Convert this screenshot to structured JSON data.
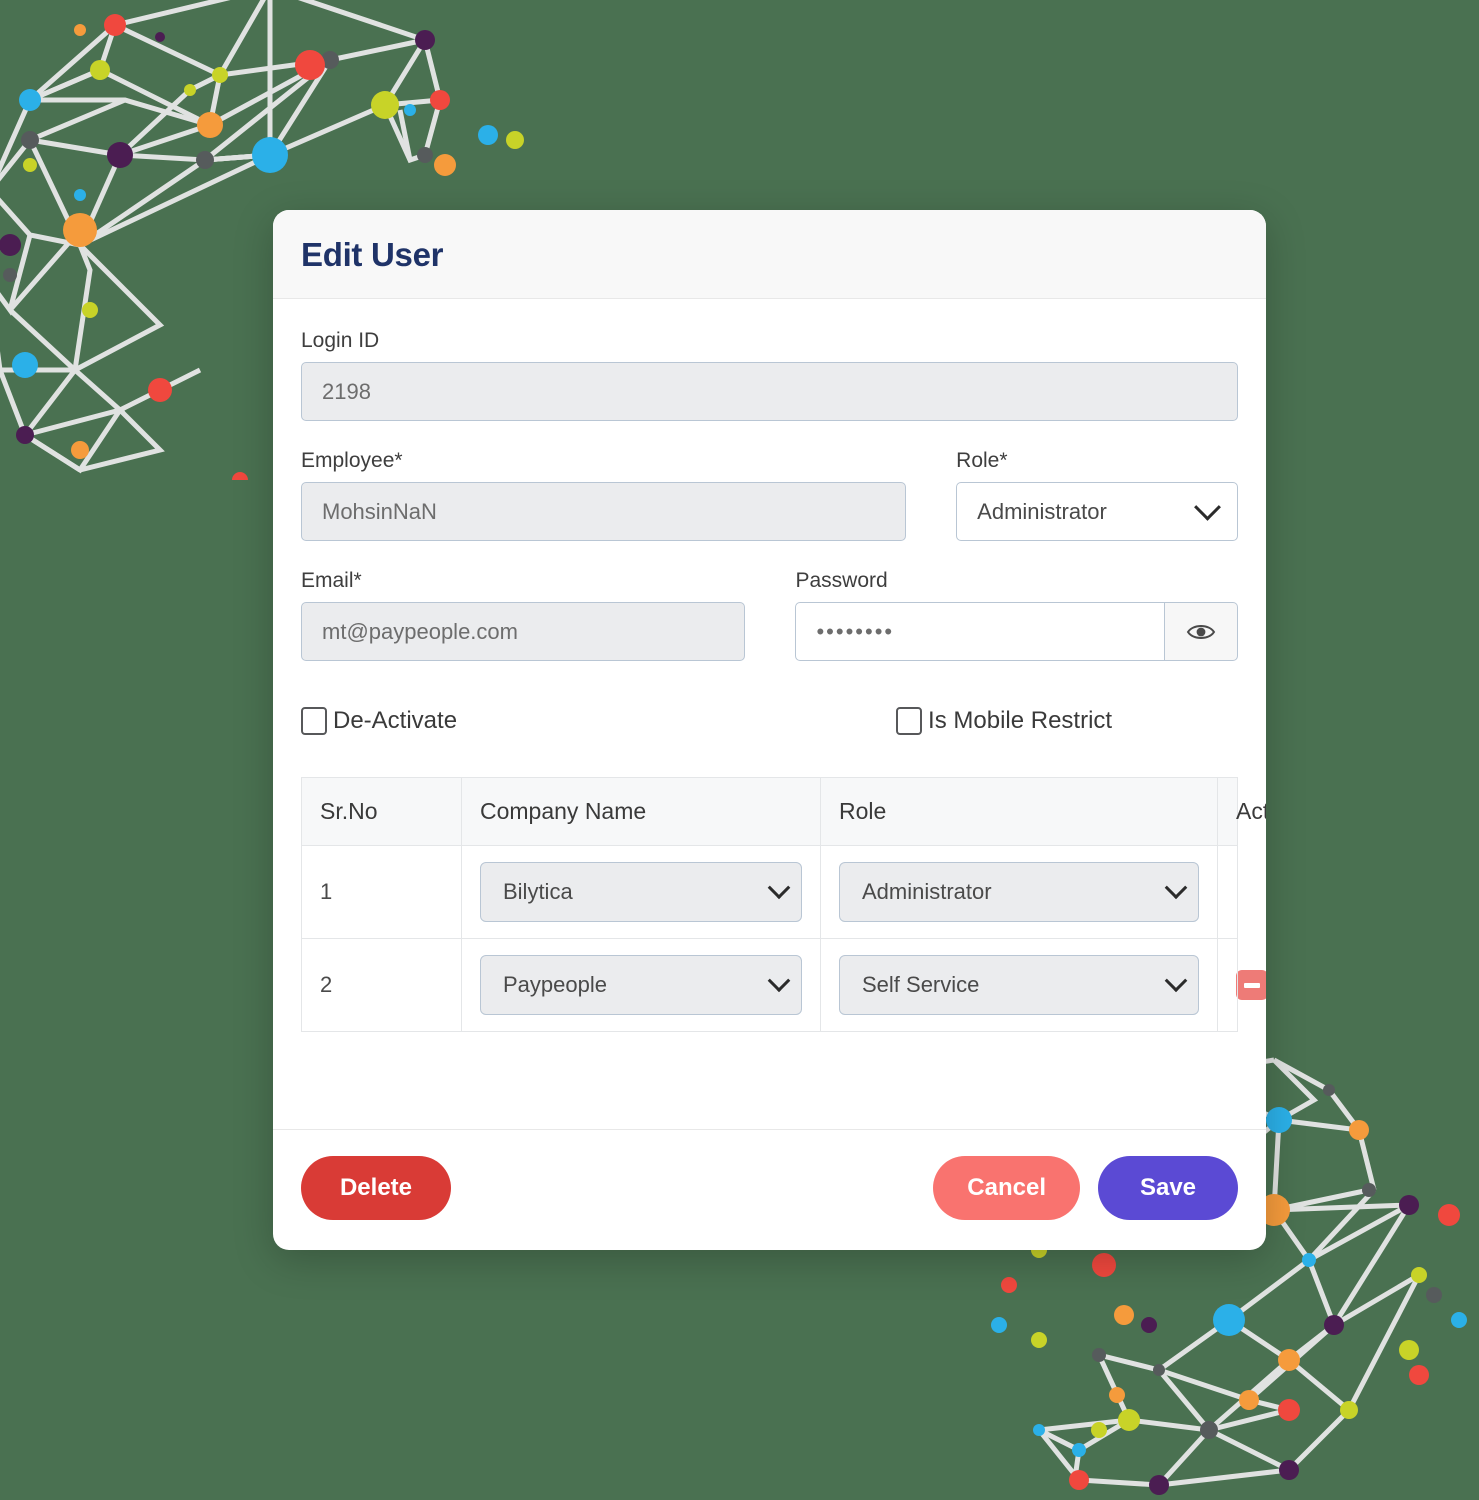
{
  "theme": {
    "page_background": "#4a7151",
    "title_color": "#1f3368",
    "delete_color": "#d93b36",
    "cancel_color": "#f9736f",
    "save_color": "#5b4ad4",
    "row_action_color": "#ee7b77"
  },
  "modal": {
    "title": "Edit User",
    "fields": {
      "login_id": {
        "label": "Login ID",
        "value": "2198",
        "placeholder": "Login ID"
      },
      "employee": {
        "label": "Employee*",
        "value": "MohsinNaN",
        "placeholder": "Employee"
      },
      "role": {
        "label": "Role*",
        "value": "Administrator"
      },
      "email": {
        "label": "Email*",
        "value": "mt@paypeople.com",
        "placeholder": "Email"
      },
      "password": {
        "label": "Password",
        "value": "••••••••",
        "placeholder": "Password",
        "toggle_icon": "eye-icon"
      }
    },
    "checkboxes": [
      {
        "label": "De-Activate",
        "checked": false
      },
      {
        "label": "Is Mobile Restrict",
        "checked": false
      }
    ],
    "table": {
      "columns": [
        "Sr.No",
        "Company Name",
        "Role",
        "Actions"
      ],
      "rows": [
        {
          "sr_no": "1",
          "company": "Bilytica",
          "role": "Administrator",
          "action": ""
        },
        {
          "sr_no": "2",
          "company": "Paypeople",
          "role": "Self Service",
          "action": "remove-icon"
        }
      ]
    },
    "footer": {
      "delete_label": "Delete",
      "cancel_label": "Cancel",
      "save_label": "Save"
    }
  }
}
